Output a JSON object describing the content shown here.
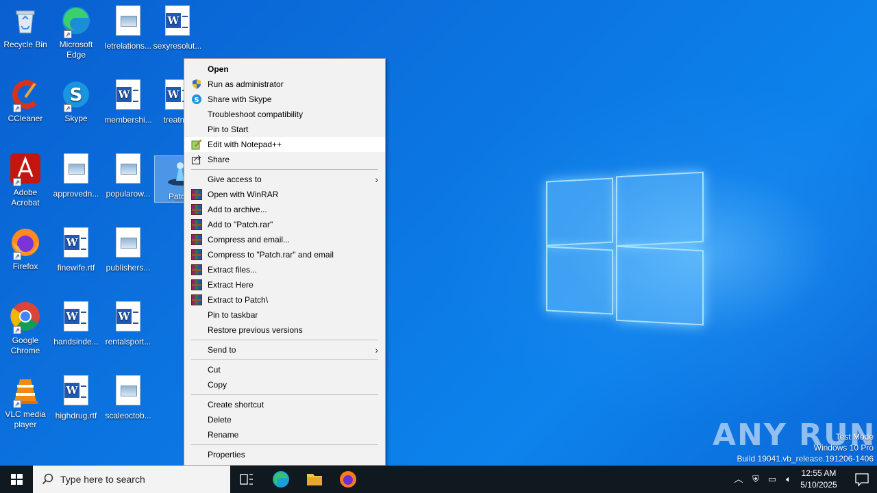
{
  "desktop": {
    "icons": [
      {
        "label": "Recycle Bin",
        "type": "recycle"
      },
      {
        "label": "Microsoft Edge",
        "type": "edge"
      },
      {
        "label": "letrelations...",
        "type": "image"
      },
      {
        "label": "sexyresolut...",
        "type": "word"
      },
      {
        "label": "CCleaner",
        "type": "ccleaner"
      },
      {
        "label": "Skype",
        "type": "skype"
      },
      {
        "label": "membershi...",
        "type": "word"
      },
      {
        "label": "treatme",
        "type": "word"
      },
      {
        "label": "Adobe Acrobat",
        "type": "acrobat"
      },
      {
        "label": "approvedn...",
        "type": "image"
      },
      {
        "label": "popularow...",
        "type": "image"
      },
      {
        "label": "Patch.",
        "type": "exe"
      },
      {
        "label": "Firefox",
        "type": "firefox"
      },
      {
        "label": "finewife.rtf",
        "type": "word"
      },
      {
        "label": "publishers...",
        "type": "image"
      },
      {
        "label": "Google Chrome",
        "type": "chrome"
      },
      {
        "label": "handsinde...",
        "type": "word"
      },
      {
        "label": "rentalsport...",
        "type": "word"
      },
      {
        "label": "VLC media player",
        "type": "vlc"
      },
      {
        "label": "highdrug.rtf",
        "type": "word"
      },
      {
        "label": "scaleoctob...",
        "type": "image"
      }
    ]
  },
  "context_menu": {
    "items": [
      {
        "label": "Open",
        "bold": true,
        "icon": ""
      },
      {
        "label": "Run as administrator",
        "icon": "shield-icon"
      },
      {
        "label": "Share with Skype",
        "icon": "skype-icon"
      },
      {
        "label": "Troubleshoot compatibility",
        "icon": ""
      },
      {
        "label": "Pin to Start",
        "icon": ""
      },
      {
        "label": "Edit with Notepad++",
        "icon": "notepadpp-icon",
        "hover": true
      },
      {
        "label": "Share",
        "icon": "share-icon"
      },
      {
        "sep": true
      },
      {
        "label": "Give access to",
        "icon": "",
        "submenu": true
      },
      {
        "label": "Open with WinRAR",
        "icon": "winrar-icon"
      },
      {
        "label": "Add to archive...",
        "icon": "winrar-icon"
      },
      {
        "label": "Add to \"Patch.rar\"",
        "icon": "winrar-icon"
      },
      {
        "label": "Compress and email...",
        "icon": "winrar-icon"
      },
      {
        "label": "Compress to \"Patch.rar\" and email",
        "icon": "winrar-icon"
      },
      {
        "label": "Extract files...",
        "icon": "winrar-icon"
      },
      {
        "label": "Extract Here",
        "icon": "winrar-icon"
      },
      {
        "label": "Extract to Patch\\",
        "icon": "winrar-icon"
      },
      {
        "label": "Pin to taskbar",
        "icon": ""
      },
      {
        "label": "Restore previous versions",
        "icon": ""
      },
      {
        "sep": true
      },
      {
        "label": "Send to",
        "icon": "",
        "submenu": true
      },
      {
        "sep": true
      },
      {
        "label": "Cut",
        "icon": ""
      },
      {
        "label": "Copy",
        "icon": ""
      },
      {
        "sep": true
      },
      {
        "label": "Create shortcut",
        "icon": ""
      },
      {
        "label": "Delete",
        "icon": ""
      },
      {
        "label": "Rename",
        "icon": ""
      },
      {
        "sep": true
      },
      {
        "label": "Properties",
        "icon": ""
      }
    ]
  },
  "taskbar": {
    "search_placeholder": "Type here to search",
    "clock_time": "12:55 AM",
    "clock_date": "5/10/2025"
  },
  "watermark": {
    "logo_text": "ANY RUN",
    "line1": "Test Mode",
    "line2": "Windows 10 Pro",
    "line3": "Build 19041.vb_release.191206-1406"
  },
  "colors": {
    "desktop_blue": "#0b74e0",
    "menu_bg": "#f2f2f2",
    "taskbar_bg": "#101820"
  }
}
